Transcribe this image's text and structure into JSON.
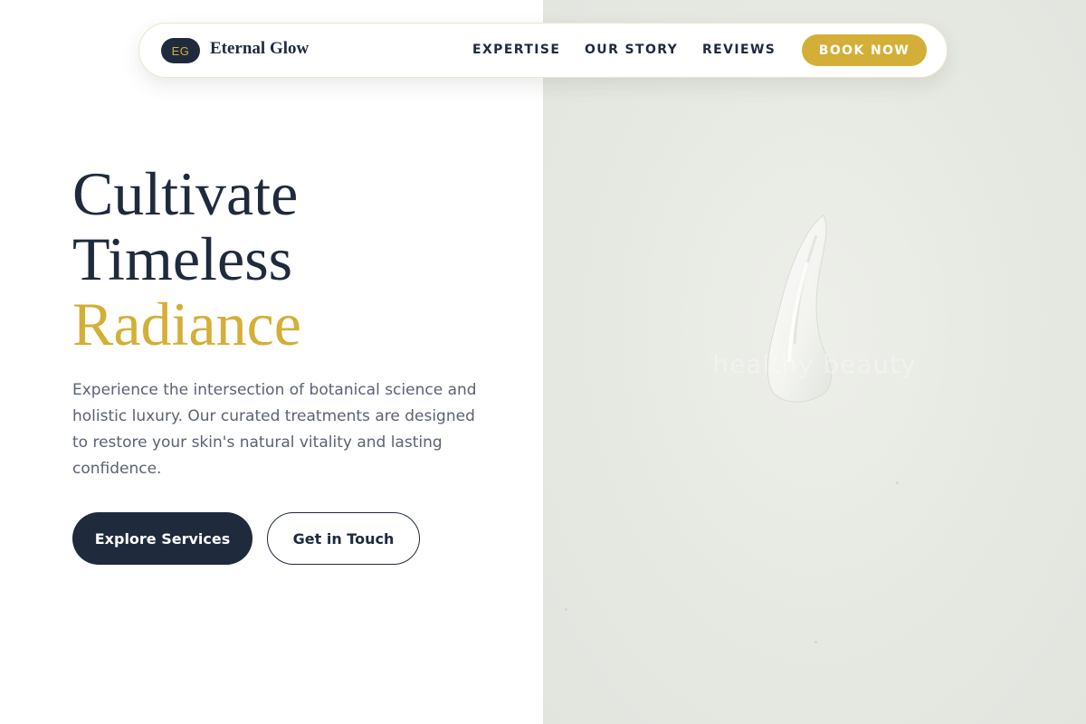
{
  "brand": {
    "logo_initials": "EG",
    "name": "Eternal Glow"
  },
  "nav": {
    "links": [
      "EXPERTISE",
      "OUR STORY",
      "REVIEWS"
    ],
    "cta_label": "BOOK NOW"
  },
  "hero": {
    "headline_line1": "Cultivate",
    "headline_line2": "Timeless",
    "headline_accent": "Radiance",
    "description": "Experience the intersection of botanical science and holistic luxury. Our curated treatments are designed to restore your skin's natural vitality and lasting confidence.",
    "primary_button": "Explore Services",
    "secondary_button": "Get in Touch",
    "image_watermark": "healthy beauty"
  },
  "colors": {
    "navy": "#1f2a3d",
    "gold": "#d4af37",
    "body_text": "#5b6271",
    "image_background": "#e6e9e2"
  }
}
